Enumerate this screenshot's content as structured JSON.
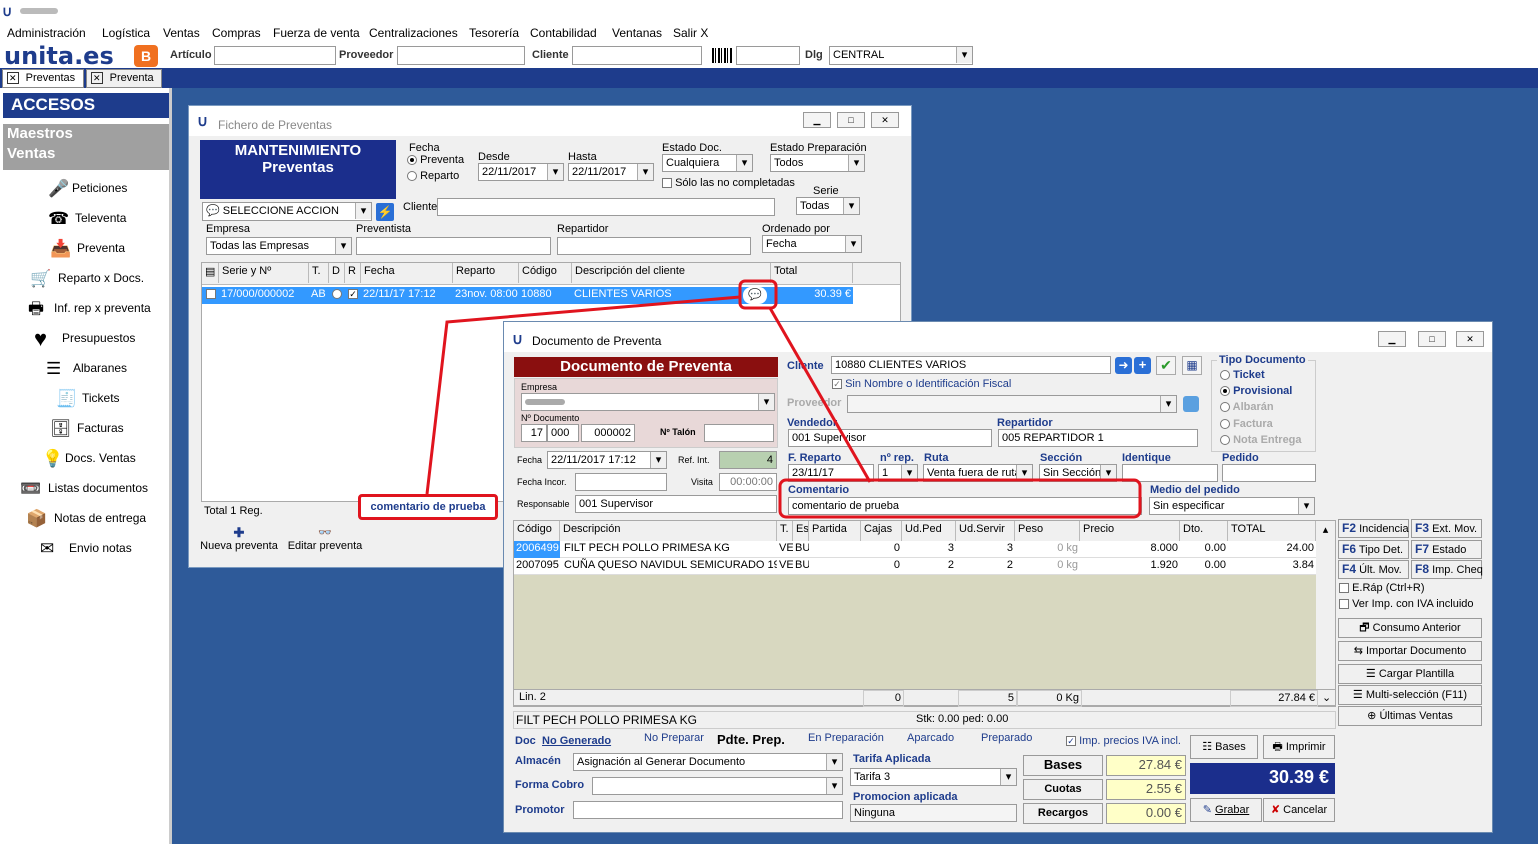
{
  "menu": [
    "Administración",
    "Logística",
    "Ventas",
    "Compras",
    "Fuerza de venta",
    "Centralizaciones",
    "Tesorería",
    "Contabilidad",
    "Ventanas",
    "Salir X"
  ],
  "brand": {
    "logo_text": "unita.es",
    "accent": "#1e3c8c",
    "orange": "#f07020"
  },
  "searchbar": {
    "articulo_label": "Artículo",
    "proveedor_label": "Proveedor",
    "cliente_label": "Cliente",
    "dlg_label": "Dlg",
    "dlg_value": "CENTRAL"
  },
  "tabs": [
    "Preventas",
    "Preventa"
  ],
  "sidebar": {
    "header": "ACCESOS RAPIDOS",
    "groups": [
      "Maestros",
      "Ventas"
    ],
    "items": [
      {
        "icon": "microphone-icon",
        "label": "Peticiones"
      },
      {
        "icon": "phone-icon",
        "label": "Televenta"
      },
      {
        "icon": "inbox-download-icon",
        "label": "Preventa"
      },
      {
        "icon": "cart-icon",
        "label": "Reparto x Docs."
      },
      {
        "icon": "printer-icon",
        "label": "Inf. rep x preventa"
      },
      {
        "icon": "heart-icon",
        "label": "Presupuestos"
      },
      {
        "icon": "list-icon",
        "label": "Albaranes"
      },
      {
        "icon": "receipt-icon",
        "label": "Tickets"
      },
      {
        "icon": "cabinet-icon",
        "label": "Facturas"
      },
      {
        "icon": "bulb-icon",
        "label": "Docs. Ventas"
      },
      {
        "icon": "tape-icon",
        "label": "Listas documentos"
      },
      {
        "icon": "box-icon",
        "label": "Notas de entrega"
      },
      {
        "icon": "envelope-icon",
        "label": "Envio notas"
      }
    ]
  },
  "fichero": {
    "title": "Fichero de Preventas",
    "header_line1": "MANTENIMIENTO",
    "header_line2": "Preventas",
    "fecha_label": "Fecha",
    "radio_preventa": "Preventa",
    "radio_reparto": "Reparto",
    "desde_label": "Desde",
    "desde_value": "22/11/2017",
    "hasta_label": "Hasta",
    "hasta_value": "22/11/2017",
    "estado_doc_label": "Estado Doc.",
    "estado_doc_value": "Cualquiera",
    "estado_prep_label": "Estado Preparación",
    "estado_prep_value": "Todos",
    "solo_label": "Sólo las no completadas",
    "serie_label": "Serie",
    "serie_value": "Todas",
    "accion_value": "SELECCIONE ACCION",
    "cliente_label": "Cliente",
    "empresa_label": "Empresa",
    "empresa_value": "Todas las Empresas",
    "preventista_label": "Preventista",
    "repartidor_label": "Repartidor",
    "ordenado_label": "Ordenado por",
    "ordenado_value": "Fecha",
    "columns": [
      "Serie y Nº",
      "T.",
      "D",
      "R",
      "Fecha",
      "Reparto",
      "Código",
      "Descripción del cliente",
      "Total"
    ],
    "rows": [
      {
        "serie": "17/000/000002",
        "t": "AB",
        "fecha": "22/11/17 17:12",
        "reparto": "23nov. 08:00",
        "codigo": "10880",
        "descripcion": "CLIENTES VARIOS",
        "total": "30.39 €"
      }
    ],
    "total_reg": "Total 1 Reg.",
    "nueva_label": "Nueva preventa",
    "editar_label": "Editar preventa"
  },
  "annotation": {
    "text": "comentario de prueba",
    "color": "#e0141e"
  },
  "documento": {
    "title": "Documento de Preventa",
    "header": "Documento de Preventa",
    "empresa_label": "Empresa",
    "num_doc_label": "Nº Documento",
    "num_a": "17",
    "num_b": "000",
    "num_c": "000002",
    "talon_label": "Nº Talón",
    "fecha_label": "Fecha",
    "fecha_value": "22/11/2017 17:12",
    "ref_int_label": "Ref. Int.",
    "ref_int_value": "4",
    "fecha_incor_label": "Fecha Incor.",
    "visita_label": "Visita",
    "visita_value": "00:00:00",
    "responsable_label": "Responsable",
    "responsable_value": "001 Supervisor",
    "cliente_label": "Cliente",
    "cliente_value": "10880 CLIENTES VARIOS",
    "sin_nombre_label": "Sin Nombre o Identificación Fiscal",
    "proveedor_label": "Proveedor",
    "vendedor_label": "Vendedor",
    "vendedor_value": "001 Supervisor",
    "repartidor_label": "Repartidor",
    "repartidor_value": "005 REPARTIDOR 1",
    "f_reparto_label": "F. Reparto",
    "f_reparto_value": "23/11/17",
    "nrep_label": "nº rep.",
    "nrep_value": "1",
    "ruta_label": "Ruta",
    "ruta_value": "Venta fuera de ruta",
    "seccion_label": "Sección",
    "seccion_value": "Sin Sección",
    "identique_label": "Identique",
    "pedido_label": "Pedido",
    "comentario_label": "Comentario",
    "comentario_value": "comentario de prueba",
    "medio_label": "Medio del pedido",
    "medio_value": "Sin especificar",
    "tipo_doc_label": "Tipo Documento",
    "tipo_options": [
      "Ticket",
      "Provisional",
      "Albarán",
      "Factura",
      "Nota Entrega"
    ],
    "tipo_selected": "Provisional",
    "columns": [
      "Código",
      "Descripción",
      "T.",
      "Es",
      "Partida",
      "Cajas",
      "Ud.Ped",
      "Ud.Servir",
      "Peso",
      "Precio",
      "Dto.",
      "TOTAL"
    ],
    "lines": [
      {
        "codigo": "2006499",
        "descripcion": "FILT PECH POLLO PRIMESA KG",
        "t": "VE",
        "es": "BU",
        "partida": "",
        "cajas": "0",
        "udped": "3",
        "udservir": "3",
        "peso": "0 kg",
        "precio": "8.000",
        "dto": "0.00",
        "total": "24.00"
      },
      {
        "codigo": "2007095",
        "descripcion": "CUÑA QUESO NAVIDUL SEMICURADO 19",
        "t": "VE",
        "es": "BU",
        "partida": "",
        "cajas": "0",
        "udped": "2",
        "udservir": "2",
        "peso": "0 kg",
        "precio": "1.920",
        "dto": "0.00",
        "total": "3.84"
      }
    ],
    "lin_label": "Lin. 2",
    "sum_cajas": "0",
    "sum_servir": "5",
    "sum_peso": "0 Kg",
    "sum_total": "27.84 €",
    "selected_desc": "FILT PECH POLLO PRIMESA KG",
    "stock_text": "Stk: 0.00 ped: 0.00",
    "doc_label": "Doc",
    "no_generado": "No Generado",
    "no_preparar": "No Preparar",
    "pdte_prep": "Pdte. Prep.",
    "en_prep": "En Preparación",
    "aparcado": "Aparcado",
    "preparado": "Preparado",
    "almacen_label": "Almacén",
    "almacen_value": "Asignación al Generar Documento",
    "forma_cobro_label": "Forma Cobro",
    "promotor_label": "Promotor",
    "tarifa_label": "Tarifa Aplicada",
    "tarifa_value": "Tarifa 3",
    "promocion_label": "Promocion aplicada",
    "promocion_value": "Ninguna",
    "bases_label": "Bases",
    "bases_value": "27.84 €",
    "cuotas_label": "Cuotas",
    "cuotas_value": "2.55 €",
    "recargos_label": "Recargos",
    "recargos_value": "0.00 €",
    "imp_iva_label": "Imp. precios IVA incl.",
    "bases_btn": "Bases",
    "imprimir_btn": "Imprimir",
    "grand_total": "30.39 €",
    "grabar_btn": "Grabar",
    "cancelar_btn": "Cancelar",
    "fkeys": [
      [
        "F2",
        "Incidencia"
      ],
      [
        "F3",
        "Ext. Mov."
      ],
      [
        "F6",
        "Tipo Det."
      ],
      [
        "F7",
        "Estado"
      ],
      [
        "F4",
        "Últ. Mov."
      ],
      [
        "F8",
        "Imp. Cheq"
      ]
    ],
    "erap_label": "E.Ráp (Ctrl+R)",
    "ver_imp_label": "Ver Imp. con IVA incluido",
    "side_buttons": [
      "Consumo Anterior",
      "Importar Documento",
      "Cargar Plantilla",
      "Multi-selección (F11)",
      "Últimas Ventas"
    ]
  }
}
